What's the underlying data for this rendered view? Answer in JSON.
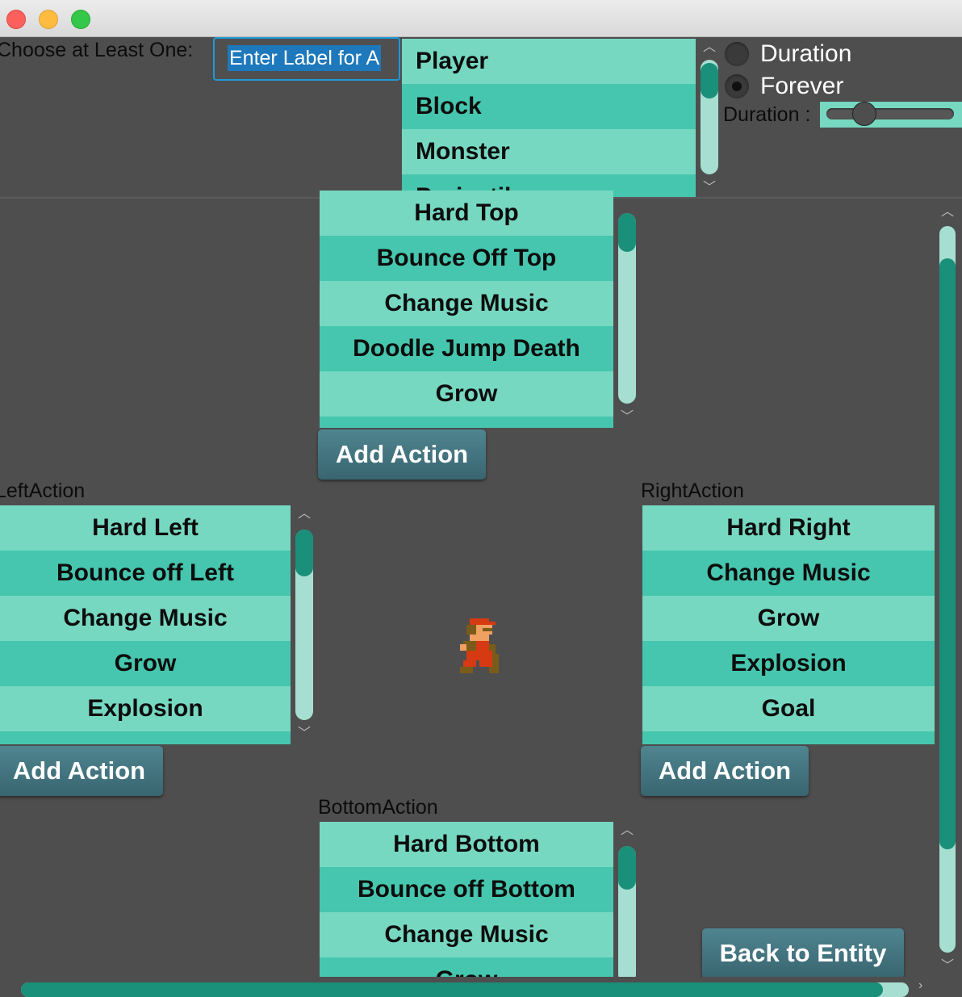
{
  "window": {
    "controls": [
      "close",
      "minimize",
      "maximize"
    ]
  },
  "top_pane": {
    "choose_label": "Choose at Least One:",
    "label_input": {
      "value": "Enter Label for A"
    },
    "entity_types": [
      "Player",
      "Block",
      "Monster",
      "Projectile"
    ],
    "radio_options": [
      {
        "label": "Duration",
        "checked": false
      },
      {
        "label": "Forever",
        "checked": true
      }
    ],
    "duration_label": "Duration :"
  },
  "top_action": {
    "items": [
      "Hard Top",
      "Bounce Off Top",
      "Change Music",
      "Doodle Jump Death",
      "Grow"
    ],
    "add_button": "Add Action"
  },
  "left_action": {
    "title": "LeftAction",
    "items": [
      "Hard Left",
      "Bounce off Left",
      "Change Music",
      "Grow",
      "Explosion"
    ],
    "add_button": "Add Action"
  },
  "right_action": {
    "title": "RightAction",
    "items": [
      "Hard Right",
      "Change Music",
      "Grow",
      "Explosion",
      "Goal"
    ],
    "add_button": "Add Action"
  },
  "bottom_action": {
    "title": "BottomAction",
    "items": [
      "Hard Bottom",
      "Bounce off Bottom",
      "Change Music",
      "Grow"
    ]
  },
  "back_button": "Back to Entity",
  "colors": {
    "background": "#4e4e4e",
    "list_light": "#77d8c2",
    "list_dark": "#46c6ae",
    "scroll_thumb": "#1a8f79",
    "button": "#447480"
  },
  "icons": {
    "character_sprite": "mario-sprite",
    "scroll_up": "chevron-up-icon",
    "scroll_down": "chevron-down-icon"
  }
}
